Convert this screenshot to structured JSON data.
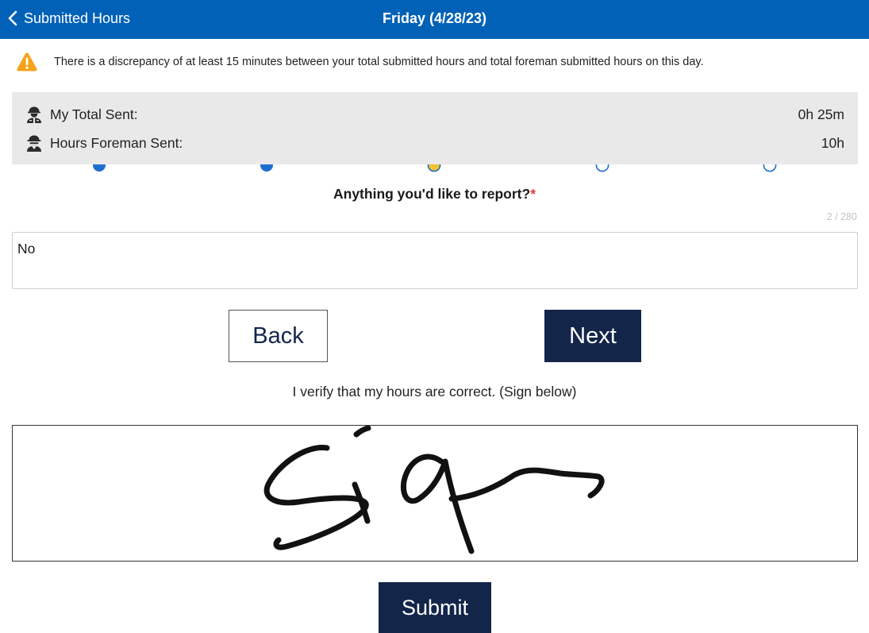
{
  "header": {
    "back_label": "Submitted Hours",
    "title": "Friday (4/28/23)",
    "background": "#0061b7"
  },
  "warning": {
    "icon": "warning-triangle-icon",
    "color": "#f7a21b",
    "text": "There is a discrepancy of at least 15 minutes between your total submitted hours and total foreman submitted hours on this day."
  },
  "summary": {
    "my_total_label": "My Total Sent:",
    "my_total_value": "0h 25m",
    "my_total_icon": "worker-icon",
    "foreman_label": "Hours Foreman Sent:",
    "foreman_value": "10h",
    "foreman_icon": "foreman-icon"
  },
  "steps": {
    "count": 5,
    "current_index": 2,
    "completed_color": "#1f6fd1",
    "current_color": "#f2c230"
  },
  "report": {
    "question": "Anything you'd like to report?",
    "required_marker": "*",
    "counter": "2 / 280",
    "value": "No"
  },
  "buttons": {
    "back_label": "Back",
    "next_label": "Next",
    "submit_label": "Submit",
    "dark_color": "#14254a"
  },
  "signature": {
    "verify_text": "I verify that my hours are correct. (Sign below)"
  }
}
